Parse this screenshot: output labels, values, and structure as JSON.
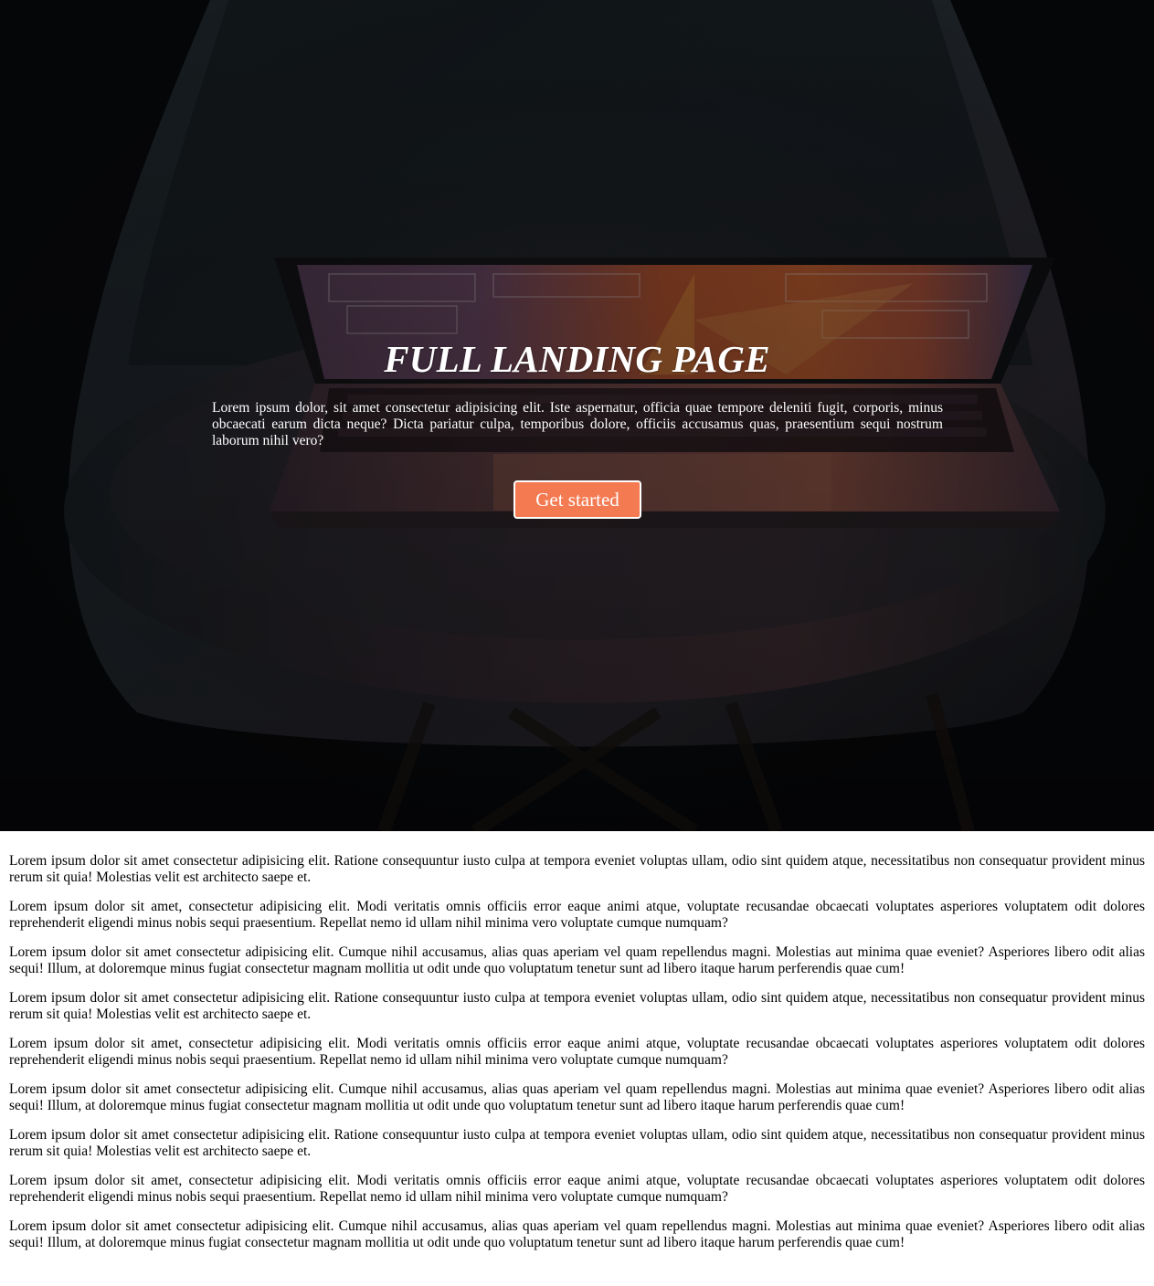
{
  "hero": {
    "title": "FULL LANDING PAGE",
    "text": "Lorem ipsum dolor, sit amet consectetur adipisicing elit. Iste aspernatur, officia quae tempore deleniti fugit, corporis, minus obcaecati earum dicta neque? Dicta pariatur culpa, temporibus dolore, officiis accusamus quas, praesentium sequi nostrum laborum nihil vero?",
    "button_label": "Get started",
    "button_color": "#f47a52",
    "background_image": "laptop-on-chair-photo"
  },
  "content": {
    "paragraphs": [
      "Lorem ipsum dolor sit amet consectetur adipisicing elit. Ratione consequuntur iusto culpa at tempora eveniet voluptas ullam, odio sint quidem atque, necessitatibus non consequatur provident minus rerum sit quia! Molestias velit est architecto saepe et.",
      "Lorem ipsum dolor sit amet, consectetur adipisicing elit. Modi veritatis omnis officiis error eaque animi atque, voluptate recusandae obcaecati voluptates asperiores voluptatem odit dolores reprehenderit eligendi minus nobis sequi praesentium. Repellat nemo id ullam nihil minima vero voluptate cumque numquam?",
      "Lorem ipsum dolor sit amet consectetur adipisicing elit. Cumque nihil accusamus, alias quas aperiam vel quam repellendus magni. Molestias aut minima quae eveniet? Asperiores libero odit alias sequi! Illum, at doloremque minus fugiat consectetur magnam mollitia ut odit unde quo voluptatum tenetur sunt ad libero itaque harum perferendis quae cum!",
      "Lorem ipsum dolor sit amet consectetur adipisicing elit. Ratione consequuntur iusto culpa at tempora eveniet voluptas ullam, odio sint quidem atque, necessitatibus non consequatur provident minus rerum sit quia! Molestias velit est architecto saepe et.",
      "Lorem ipsum dolor sit amet, consectetur adipisicing elit. Modi veritatis omnis officiis error eaque animi atque, voluptate recusandae obcaecati voluptates asperiores voluptatem odit dolores reprehenderit eligendi minus nobis sequi praesentium. Repellat nemo id ullam nihil minima vero voluptate cumque numquam?",
      "Lorem ipsum dolor sit amet consectetur adipisicing elit. Cumque nihil accusamus, alias quas aperiam vel quam repellendus magni. Molestias aut minima quae eveniet? Asperiores libero odit alias sequi! Illum, at doloremque minus fugiat consectetur magnam mollitia ut odit unde quo voluptatum tenetur sunt ad libero itaque harum perferendis quae cum!",
      "Lorem ipsum dolor sit amet consectetur adipisicing elit. Ratione consequuntur iusto culpa at tempora eveniet voluptas ullam, odio sint quidem atque, necessitatibus non consequatur provident minus rerum sit quia! Molestias velit est architecto saepe et.",
      "Lorem ipsum dolor sit amet, consectetur adipisicing elit. Modi veritatis omnis officiis error eaque animi atque, voluptate recusandae obcaecati voluptates asperiores voluptatem odit dolores reprehenderit eligendi minus nobis sequi praesentium. Repellat nemo id ullam nihil minima vero voluptate cumque numquam?",
      "Lorem ipsum dolor sit amet consectetur adipisicing elit. Cumque nihil accusamus, alias quas aperiam vel quam repellendus magni. Molestias aut minima quae eveniet? Asperiores libero odit alias sequi! Illum, at doloremque minus fugiat consectetur magnam mollitia ut odit unde quo voluptatum tenetur sunt ad libero itaque harum perferendis quae cum!"
    ]
  }
}
